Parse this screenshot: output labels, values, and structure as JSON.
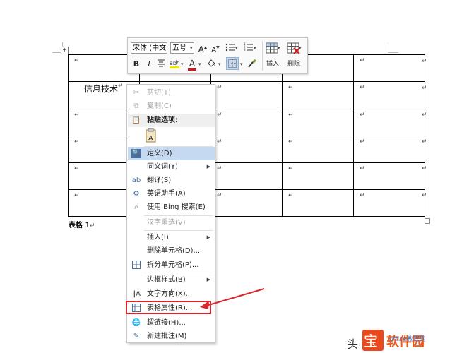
{
  "toolbar": {
    "font_name": "宋体 (中文",
    "font_size": "五号",
    "grow_font": "A",
    "shrink_font": "A",
    "bold": "B",
    "italic": "I",
    "font_color": "A",
    "insert_label": "插入",
    "delete_label": "删除"
  },
  "menu": {
    "items": [
      {
        "label": "剪切(T)",
        "icon": "scissors-icon",
        "disabled": true
      },
      {
        "label": "复制(C)",
        "icon": "copy-icon",
        "disabled": true
      },
      {
        "label": "粘贴选项:",
        "icon": "paste-icon",
        "section": true
      },
      {
        "label": "定义(D)",
        "icon": "define-icon",
        "highlighted": true
      },
      {
        "label": "同义词(Y)",
        "icon": "",
        "submenu": true
      },
      {
        "label": "翻译(S)",
        "icon": "translate-icon"
      },
      {
        "label": "英语助手(A)",
        "icon": "english-assistant-icon"
      },
      {
        "label": "使用 Bing 搜索(E)",
        "icon": "bing-search-icon"
      },
      {
        "label": "汉字重选(V)",
        "icon": "",
        "disabled": true
      },
      {
        "label": "插入(I)",
        "icon": "",
        "submenu": true
      },
      {
        "label": "删除单元格(D)...",
        "icon": ""
      },
      {
        "label": "拆分单元格(P)...",
        "icon": "split-cells-icon"
      },
      {
        "label": "边框样式(B)",
        "icon": "",
        "submenu": true
      },
      {
        "label": "文字方向(X)...",
        "icon": "text-direction-icon"
      },
      {
        "label": "表格属性(R)...",
        "icon": "table-properties-icon"
      },
      {
        "label": "超链接(H)...",
        "icon": "hyperlink-icon"
      },
      {
        "label": "新建批注(M)",
        "icon": "new-comment-icon"
      }
    ]
  },
  "table": {
    "cell_text": "信息技术",
    "caption_label": "表格",
    "caption_number": "1"
  },
  "colors": {
    "highlight": "#c5d9f0",
    "annotation_red": "#d9262b",
    "font_color_red": "#d0191e"
  }
}
